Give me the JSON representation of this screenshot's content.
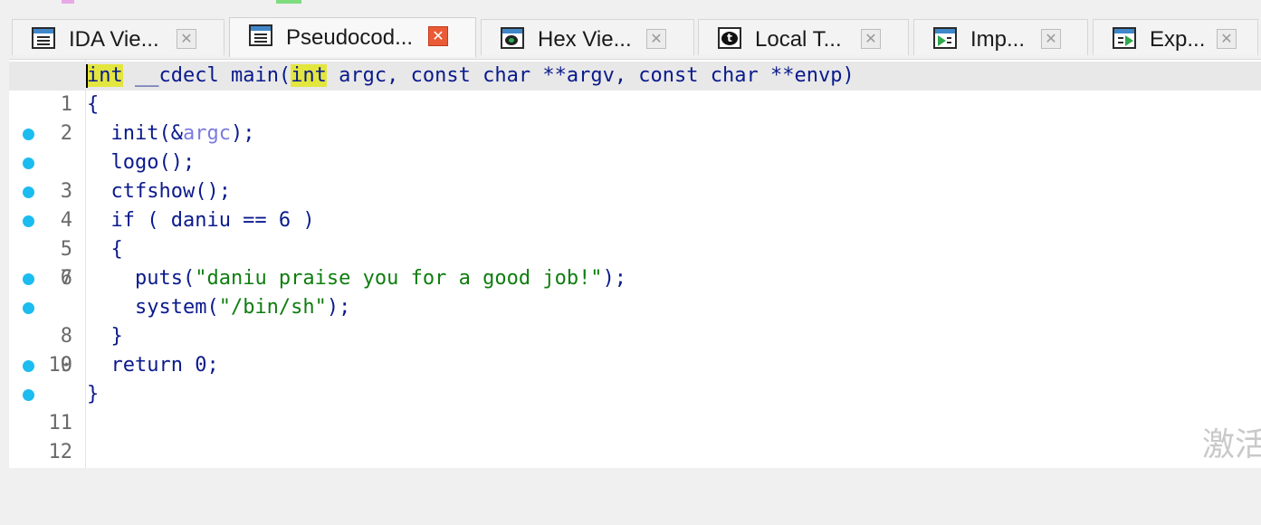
{
  "tabs": [
    {
      "label": "IDA Vie...",
      "icon": "ida-view-icon",
      "active": false
    },
    {
      "label": "Pseudocod...",
      "icon": "pseudocode-icon",
      "active": true
    },
    {
      "label": "Hex Vie...",
      "icon": "hex-view-icon",
      "active": false
    },
    {
      "label": "Local T...",
      "icon": "local-types-icon",
      "active": false
    },
    {
      "label": "Imp...",
      "icon": "imports-icon",
      "active": false
    },
    {
      "label": "Exp...",
      "icon": "exports-icon",
      "active": false
    }
  ],
  "close_glyph": "✕",
  "code_lines": [
    {
      "num": "1",
      "has_dot": false,
      "parts": {
        "kw1": "int",
        "a": " __cdecl main(",
        "kw2": "int",
        "b": " argc, const char **argv, const char **envp)"
      }
    },
    {
      "num": "2",
      "has_dot": false,
      "text": "{"
    },
    {
      "num": "3",
      "has_dot": true,
      "parts": {
        "a": "  init(&",
        "var": "argc",
        "b": ");"
      }
    },
    {
      "num": "4",
      "has_dot": true,
      "text": "  logo();"
    },
    {
      "num": "5",
      "has_dot": true,
      "text": "  ctfshow();"
    },
    {
      "num": "6",
      "has_dot": true,
      "text": "  if ( daniu == 6 )"
    },
    {
      "num": "7",
      "has_dot": false,
      "text": "  {"
    },
    {
      "num": "8",
      "has_dot": true,
      "parts": {
        "a": "    puts(",
        "str": "\"daniu praise you for a good job!\"",
        "b": ");"
      }
    },
    {
      "num": "9",
      "has_dot": true,
      "parts": {
        "a": "    system(",
        "str": "\"/bin/sh\"",
        "b": ");"
      }
    },
    {
      "num": "10",
      "has_dot": false,
      "text": "  }"
    },
    {
      "num": "11",
      "has_dot": true,
      "text": "  return 0;"
    },
    {
      "num": "12",
      "has_dot": true,
      "text": "}"
    }
  ],
  "watermark": "激活",
  "colors": {
    "code_text": "#0a1a8c",
    "keyword_highlight": "#e3e63e",
    "string": "#0f7d0f",
    "variable": "#7b7be0",
    "breakpoint_dot": "#1bbcf0",
    "active_close": "#ea5a36"
  }
}
